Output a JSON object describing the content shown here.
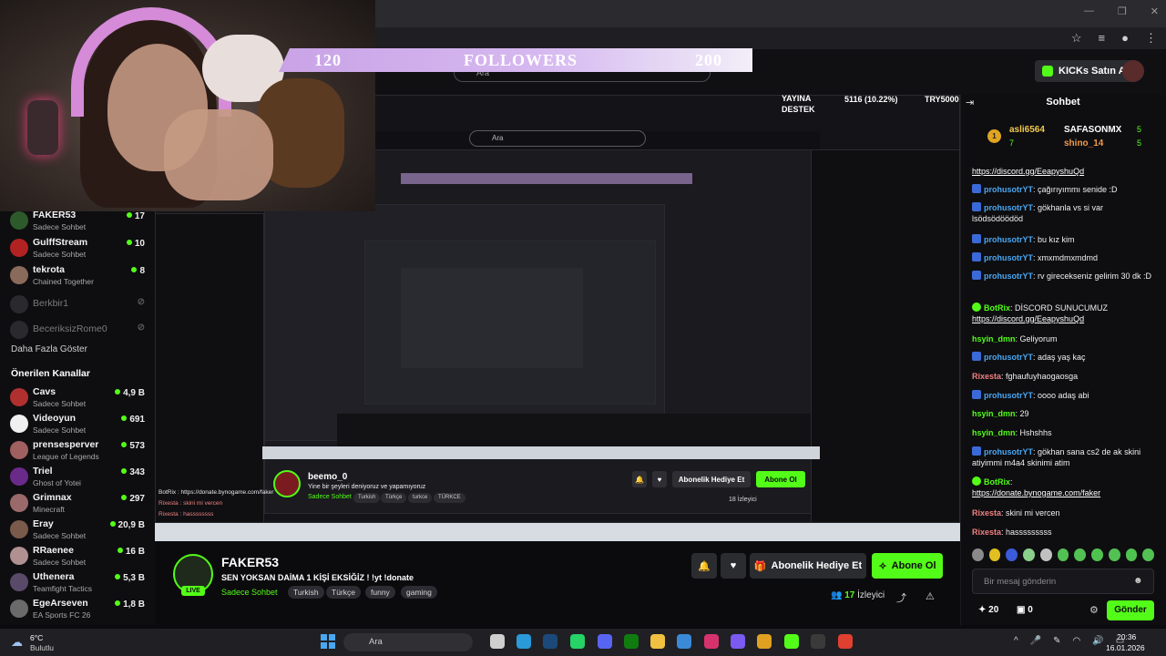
{
  "followers": {
    "left": "120",
    "label": "FOLLOWERS",
    "right": "200"
  },
  "header": {
    "kicks_label": "KICKs Satın Al",
    "search_placeholder": "Ara"
  },
  "overlay": {
    "support_label": "YAYINA\nDESTEK",
    "support_line1": "YAYINA",
    "support_line2": "DESTEK",
    "percent": "5116 (10.22%)",
    "target": "TRY5000"
  },
  "sidebar": {
    "channels": [
      {
        "name": "FAKER53",
        "category": "Sadece Sohbet",
        "count": "17",
        "color": "#2d5a2a"
      },
      {
        "name": "GulffStream",
        "category": "Sadece Sohbet",
        "count": "10",
        "color": "#b22222"
      },
      {
        "name": "tekrota",
        "category": "Chained Together",
        "count": "8",
        "color": "#8a6a5a"
      }
    ],
    "offline": [
      {
        "name": "Berkbir1"
      },
      {
        "name": "BeceriksizRome0"
      }
    ],
    "more_label": "Daha Fazla Göster",
    "recommended_label": "Önerilen Kanallar",
    "recommended": [
      {
        "name": "Cavs",
        "category": "Sadece Sohbet",
        "count": "4,9 B",
        "color": "#b03030"
      },
      {
        "name": "Videoyun",
        "category": "Sadece Sohbet",
        "count": "691",
        "color": "#f0f0f0"
      },
      {
        "name": "prensesperver",
        "category": "League of Legends",
        "count": "573",
        "color": "#a06060"
      },
      {
        "name": "Triel",
        "category": "Ghost of Yotei",
        "count": "343",
        "color": "#6a2a8a"
      },
      {
        "name": "Grimnax",
        "category": "Minecraft",
        "count": "297",
        "color": "#9a6a6a"
      },
      {
        "name": "Eray",
        "category": "Sadece Sohbet",
        "count": "20,9 B",
        "color": "#7a5a4a"
      },
      {
        "name": "RRaenee",
        "category": "Sadece Sohbet",
        "count": "16 B",
        "color": "#b09090"
      },
      {
        "name": "Uthenera",
        "category": "Teamfight Tactics",
        "count": "5,3 B",
        "color": "#5a4a6a"
      },
      {
        "name": "EgeArseven",
        "category": "EA Sports FC 26",
        "count": "1,8 B",
        "color": "#6a6a6a"
      }
    ]
  },
  "inner": {
    "name": "beemo_0",
    "title": "Yine bir şeyleri deniyoruz ve yapamıyoruz",
    "category": "Sadece Sohbet",
    "tags": [
      "Turkish",
      "Türkçe",
      "turkce",
      "TÜRKCE"
    ],
    "gift_label": "Abonelik Hediye Et",
    "sub_label": "Abone Ol",
    "viewers": "18 İzleyici",
    "botrix": "BotRix : https://donate.bynogame.com/faker",
    "rixesta1": "Rixesta : skini mi vercen",
    "rixesta2": "Rixesta : hassssssss"
  },
  "stream": {
    "name": "FAKER53",
    "title": "SEN YOKSAN DAİMA 1 KİŞİ EKSİĞİZ !  !yt !donate",
    "category": "Sadece Sohbet",
    "tags": [
      "Turkish",
      "Türkçe",
      "funny",
      "gaming"
    ],
    "live_label": "LIVE",
    "gift_label": "Abonelik Hediye Et",
    "sub_label": "Abone Ol",
    "viewer_count": "17",
    "viewer_label": "İzleyici"
  },
  "chat": {
    "title": "Sohbet",
    "pinned": [
      {
        "rank": "1",
        "name": "asli6564",
        "num": "7",
        "color": "#f2c94c"
      },
      {
        "name": "SAFASONMX",
        "num": "5",
        "color": "#ffffff"
      },
      {
        "name": "shino_14",
        "num": "5",
        "color": "#f2994a"
      }
    ],
    "messages": [
      {
        "user": "",
        "text": "https://discord.gg/EeapyshuQd",
        "link": true,
        "badge": ""
      },
      {
        "user": "prohusotrYT",
        "text": ": çağırıyımmı senide :D",
        "badge": "b",
        "color": "#4aa6f0"
      },
      {
        "user": "prohusotrYT",
        "text": ": gökhanla vs si var lsödsödöödöd",
        "badge": "b",
        "color": "#4aa6f0"
      },
      {
        "user": "prohusotrYT",
        "text": ": bu kız kim",
        "badge": "b",
        "color": "#4aa6f0"
      },
      {
        "user": "prohusotrYT",
        "text": ": xmxmdmxmdmd",
        "badge": "b",
        "color": "#4aa6f0"
      },
      {
        "user": "prohusotrYT",
        "text": ": rv girecekseniz gelirim 30 dk :D",
        "badge": "b",
        "color": "#4aa6f0"
      },
      {
        "user": "BotRix",
        "text": ": DİSCORD SUNUCUMUZ",
        "link2": "https://discord.gg/EeapyshuQd",
        "badge": "g",
        "color": "#53fc18"
      },
      {
        "user": "hsyin_dmn",
        "text": ": Geliyorum",
        "badge": "",
        "color": "#53fc18"
      },
      {
        "user": "prohusotrYT",
        "text": ": adaş yaş kaç",
        "badge": "b",
        "color": "#4aa6f0"
      },
      {
        "user": "Rixesta",
        "text": ": fghaufuyhaogaosga",
        "badge": "",
        "color": "#f08080"
      },
      {
        "user": "prohusotrYT",
        "text": ": oooo adaş abi",
        "badge": "b",
        "color": "#4aa6f0"
      },
      {
        "user": "hsyin_dmn",
        "text": ": 29",
        "badge": "",
        "color": "#53fc18"
      },
      {
        "user": "hsyin_dmn",
        "text": ": Hshshhs",
        "badge": "",
        "color": "#53fc18"
      },
      {
        "user": "prohusotrYT",
        "text": ": gökhan sana cs2 de ak skini atiyimmi m4a4 skinimi atim",
        "badge": "b",
        "color": "#4aa6f0"
      },
      {
        "user": "BotRix",
        "text": ":",
        "link2": "https://donate.bynogame.com/faker",
        "badge": "g",
        "color": "#53fc18"
      },
      {
        "user": "Rixesta",
        "text": ": skini mi vercen",
        "badge": "",
        "color": "#f08080"
      },
      {
        "user": "Rixesta",
        "text": ": hasssssssss",
        "badge": "",
        "color": "#f08080"
      }
    ],
    "input_placeholder": "Bir mesaj gönderin",
    "points": "20",
    "chest": "0",
    "send_label": "Gönder"
  },
  "taskbar": {
    "temp": "6°C",
    "weather": "Bulutlu",
    "search_placeholder": "Ara",
    "time": "20:36",
    "date": "16.01.2026"
  }
}
